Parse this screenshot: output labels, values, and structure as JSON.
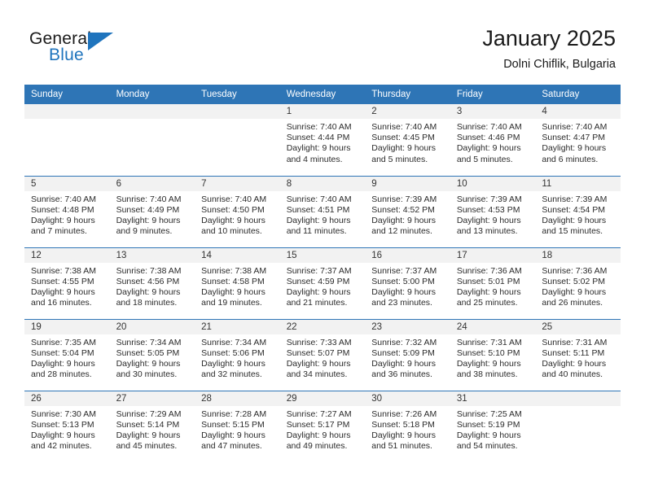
{
  "brand": {
    "name_part1": "General",
    "name_part2": "Blue",
    "accent_color": "#1f74bd",
    "triangle_icon": "triangle-right-icon"
  },
  "header": {
    "title": "January 2025",
    "subtitle": "Dolni Chiflik, Bulgaria"
  },
  "calendar": {
    "header_bg": "#2e75b6",
    "day_band_bg": "#f2f2f2",
    "weekday_headers": [
      "Sunday",
      "Monday",
      "Tuesday",
      "Wednesday",
      "Thursday",
      "Friday",
      "Saturday"
    ],
    "weeks": [
      [
        {
          "day": "",
          "sunrise": "",
          "sunset": "",
          "daylight": "",
          "empty": true
        },
        {
          "day": "",
          "sunrise": "",
          "sunset": "",
          "daylight": "",
          "empty": true
        },
        {
          "day": "",
          "sunrise": "",
          "sunset": "",
          "daylight": "",
          "empty": true
        },
        {
          "day": "1",
          "sunrise": "Sunrise: 7:40 AM",
          "sunset": "Sunset: 4:44 PM",
          "daylight": "Daylight: 9 hours and 4 minutes.",
          "empty": false
        },
        {
          "day": "2",
          "sunrise": "Sunrise: 7:40 AM",
          "sunset": "Sunset: 4:45 PM",
          "daylight": "Daylight: 9 hours and 5 minutes.",
          "empty": false
        },
        {
          "day": "3",
          "sunrise": "Sunrise: 7:40 AM",
          "sunset": "Sunset: 4:46 PM",
          "daylight": "Daylight: 9 hours and 5 minutes.",
          "empty": false
        },
        {
          "day": "4",
          "sunrise": "Sunrise: 7:40 AM",
          "sunset": "Sunset: 4:47 PM",
          "daylight": "Daylight: 9 hours and 6 minutes.",
          "empty": false
        }
      ],
      [
        {
          "day": "5",
          "sunrise": "Sunrise: 7:40 AM",
          "sunset": "Sunset: 4:48 PM",
          "daylight": "Daylight: 9 hours and 7 minutes.",
          "empty": false
        },
        {
          "day": "6",
          "sunrise": "Sunrise: 7:40 AM",
          "sunset": "Sunset: 4:49 PM",
          "daylight": "Daylight: 9 hours and 9 minutes.",
          "empty": false
        },
        {
          "day": "7",
          "sunrise": "Sunrise: 7:40 AM",
          "sunset": "Sunset: 4:50 PM",
          "daylight": "Daylight: 9 hours and 10 minutes.",
          "empty": false
        },
        {
          "day": "8",
          "sunrise": "Sunrise: 7:40 AM",
          "sunset": "Sunset: 4:51 PM",
          "daylight": "Daylight: 9 hours and 11 minutes.",
          "empty": false
        },
        {
          "day": "9",
          "sunrise": "Sunrise: 7:39 AM",
          "sunset": "Sunset: 4:52 PM",
          "daylight": "Daylight: 9 hours and 12 minutes.",
          "empty": false
        },
        {
          "day": "10",
          "sunrise": "Sunrise: 7:39 AM",
          "sunset": "Sunset: 4:53 PM",
          "daylight": "Daylight: 9 hours and 13 minutes.",
          "empty": false
        },
        {
          "day": "11",
          "sunrise": "Sunrise: 7:39 AM",
          "sunset": "Sunset: 4:54 PM",
          "daylight": "Daylight: 9 hours and 15 minutes.",
          "empty": false
        }
      ],
      [
        {
          "day": "12",
          "sunrise": "Sunrise: 7:38 AM",
          "sunset": "Sunset: 4:55 PM",
          "daylight": "Daylight: 9 hours and 16 minutes.",
          "empty": false
        },
        {
          "day": "13",
          "sunrise": "Sunrise: 7:38 AM",
          "sunset": "Sunset: 4:56 PM",
          "daylight": "Daylight: 9 hours and 18 minutes.",
          "empty": false
        },
        {
          "day": "14",
          "sunrise": "Sunrise: 7:38 AM",
          "sunset": "Sunset: 4:58 PM",
          "daylight": "Daylight: 9 hours and 19 minutes.",
          "empty": false
        },
        {
          "day": "15",
          "sunrise": "Sunrise: 7:37 AM",
          "sunset": "Sunset: 4:59 PM",
          "daylight": "Daylight: 9 hours and 21 minutes.",
          "empty": false
        },
        {
          "day": "16",
          "sunrise": "Sunrise: 7:37 AM",
          "sunset": "Sunset: 5:00 PM",
          "daylight": "Daylight: 9 hours and 23 minutes.",
          "empty": false
        },
        {
          "day": "17",
          "sunrise": "Sunrise: 7:36 AM",
          "sunset": "Sunset: 5:01 PM",
          "daylight": "Daylight: 9 hours and 25 minutes.",
          "empty": false
        },
        {
          "day": "18",
          "sunrise": "Sunrise: 7:36 AM",
          "sunset": "Sunset: 5:02 PM",
          "daylight": "Daylight: 9 hours and 26 minutes.",
          "empty": false
        }
      ],
      [
        {
          "day": "19",
          "sunrise": "Sunrise: 7:35 AM",
          "sunset": "Sunset: 5:04 PM",
          "daylight": "Daylight: 9 hours and 28 minutes.",
          "empty": false
        },
        {
          "day": "20",
          "sunrise": "Sunrise: 7:34 AM",
          "sunset": "Sunset: 5:05 PM",
          "daylight": "Daylight: 9 hours and 30 minutes.",
          "empty": false
        },
        {
          "day": "21",
          "sunrise": "Sunrise: 7:34 AM",
          "sunset": "Sunset: 5:06 PM",
          "daylight": "Daylight: 9 hours and 32 minutes.",
          "empty": false
        },
        {
          "day": "22",
          "sunrise": "Sunrise: 7:33 AM",
          "sunset": "Sunset: 5:07 PM",
          "daylight": "Daylight: 9 hours and 34 minutes.",
          "empty": false
        },
        {
          "day": "23",
          "sunrise": "Sunrise: 7:32 AM",
          "sunset": "Sunset: 5:09 PM",
          "daylight": "Daylight: 9 hours and 36 minutes.",
          "empty": false
        },
        {
          "day": "24",
          "sunrise": "Sunrise: 7:31 AM",
          "sunset": "Sunset: 5:10 PM",
          "daylight": "Daylight: 9 hours and 38 minutes.",
          "empty": false
        },
        {
          "day": "25",
          "sunrise": "Sunrise: 7:31 AM",
          "sunset": "Sunset: 5:11 PM",
          "daylight": "Daylight: 9 hours and 40 minutes.",
          "empty": false
        }
      ],
      [
        {
          "day": "26",
          "sunrise": "Sunrise: 7:30 AM",
          "sunset": "Sunset: 5:13 PM",
          "daylight": "Daylight: 9 hours and 42 minutes.",
          "empty": false
        },
        {
          "day": "27",
          "sunrise": "Sunrise: 7:29 AM",
          "sunset": "Sunset: 5:14 PM",
          "daylight": "Daylight: 9 hours and 45 minutes.",
          "empty": false
        },
        {
          "day": "28",
          "sunrise": "Sunrise: 7:28 AM",
          "sunset": "Sunset: 5:15 PM",
          "daylight": "Daylight: 9 hours and 47 minutes.",
          "empty": false
        },
        {
          "day": "29",
          "sunrise": "Sunrise: 7:27 AM",
          "sunset": "Sunset: 5:17 PM",
          "daylight": "Daylight: 9 hours and 49 minutes.",
          "empty": false
        },
        {
          "day": "30",
          "sunrise": "Sunrise: 7:26 AM",
          "sunset": "Sunset: 5:18 PM",
          "daylight": "Daylight: 9 hours and 51 minutes.",
          "empty": false
        },
        {
          "day": "31",
          "sunrise": "Sunrise: 7:25 AM",
          "sunset": "Sunset: 5:19 PM",
          "daylight": "Daylight: 9 hours and 54 minutes.",
          "empty": false
        },
        {
          "day": "",
          "sunrise": "",
          "sunset": "",
          "daylight": "",
          "empty": true
        }
      ]
    ]
  }
}
